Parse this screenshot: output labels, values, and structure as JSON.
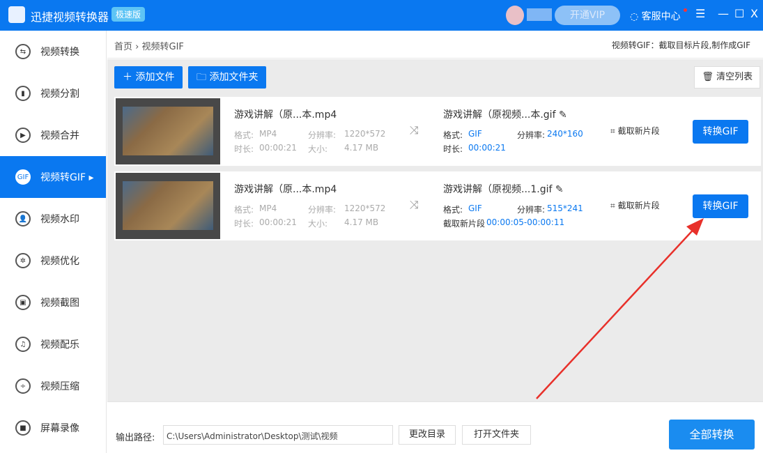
{
  "title": {
    "app": "迅捷视频转换器",
    "badge": "极速版",
    "vip": "开通VIP",
    "service": "客服中心",
    "menu": "☰",
    "min": "—",
    "max": "☐",
    "close": "X"
  },
  "sidebar": [
    {
      "label": "视频转换",
      "icon": "⇆"
    },
    {
      "label": "视频分割",
      "icon": "▮"
    },
    {
      "label": "视频合并",
      "icon": "▶"
    },
    {
      "label": "视频转GIF ▸",
      "icon": "GIF"
    },
    {
      "label": "视频水印",
      "icon": "👤"
    },
    {
      "label": "视频优化",
      "icon": "✲"
    },
    {
      "label": "视频截图",
      "icon": "▣"
    },
    {
      "label": "视频配乐",
      "icon": "♫"
    },
    {
      "label": "视频压缩",
      "icon": "÷"
    },
    {
      "label": "屏幕录像",
      "icon": "■"
    }
  ],
  "breadcrumb": {
    "home": "首页",
    "sep": "›",
    "current": "视频转GIF",
    "hint": "视频转GIF：截取目标片段,制作成GIF"
  },
  "toolbar": {
    "add_file": "＋ 添加文件",
    "add_folder": "🗀 添加文件夹",
    "clear": "🗑 清空列表"
  },
  "rows": [
    {
      "src_name": "游戏讲解（原...本.mp4",
      "fmt_label": "格式:",
      "fmt": "MP4",
      "res_label": "分辨率:",
      "res": "1220*572",
      "dur_label": "时长:",
      "dur": "00:00:21",
      "size_label": "大小:",
      "size": "4.17 MB",
      "out_name": "游戏讲解（原视频...本.gif ✎",
      "out_fmt": "GIF",
      "out_res": "240*160",
      "out_extra_label": "时长:",
      "out_extra": "00:00:21",
      "cut": "⌗ 截取新片段",
      "convert": "转换GIF"
    },
    {
      "src_name": "游戏讲解（原...本.mp4",
      "fmt_label": "格式:",
      "fmt": "MP4",
      "res_label": "分辨率:",
      "res": "1220*572",
      "dur_label": "时长:",
      "dur": "00:00:21",
      "size_label": "大小:",
      "size": "4.17 MB",
      "out_name": "游戏讲解（原视频...1.gif ✎",
      "out_fmt": "GIF",
      "out_res": "515*241",
      "out_extra_label": "截取新片段",
      "out_extra": "00:00:05-00:00:11",
      "cut": "⌗ 截取新片段",
      "convert": "转换GIF"
    }
  ],
  "footer": {
    "label": "输出路径:",
    "path": "C:\\Users\\Administrator\\Desktop\\测试\\视频",
    "change": "更改目录",
    "open": "打开文件夹",
    "convert_all": "全部转换"
  }
}
